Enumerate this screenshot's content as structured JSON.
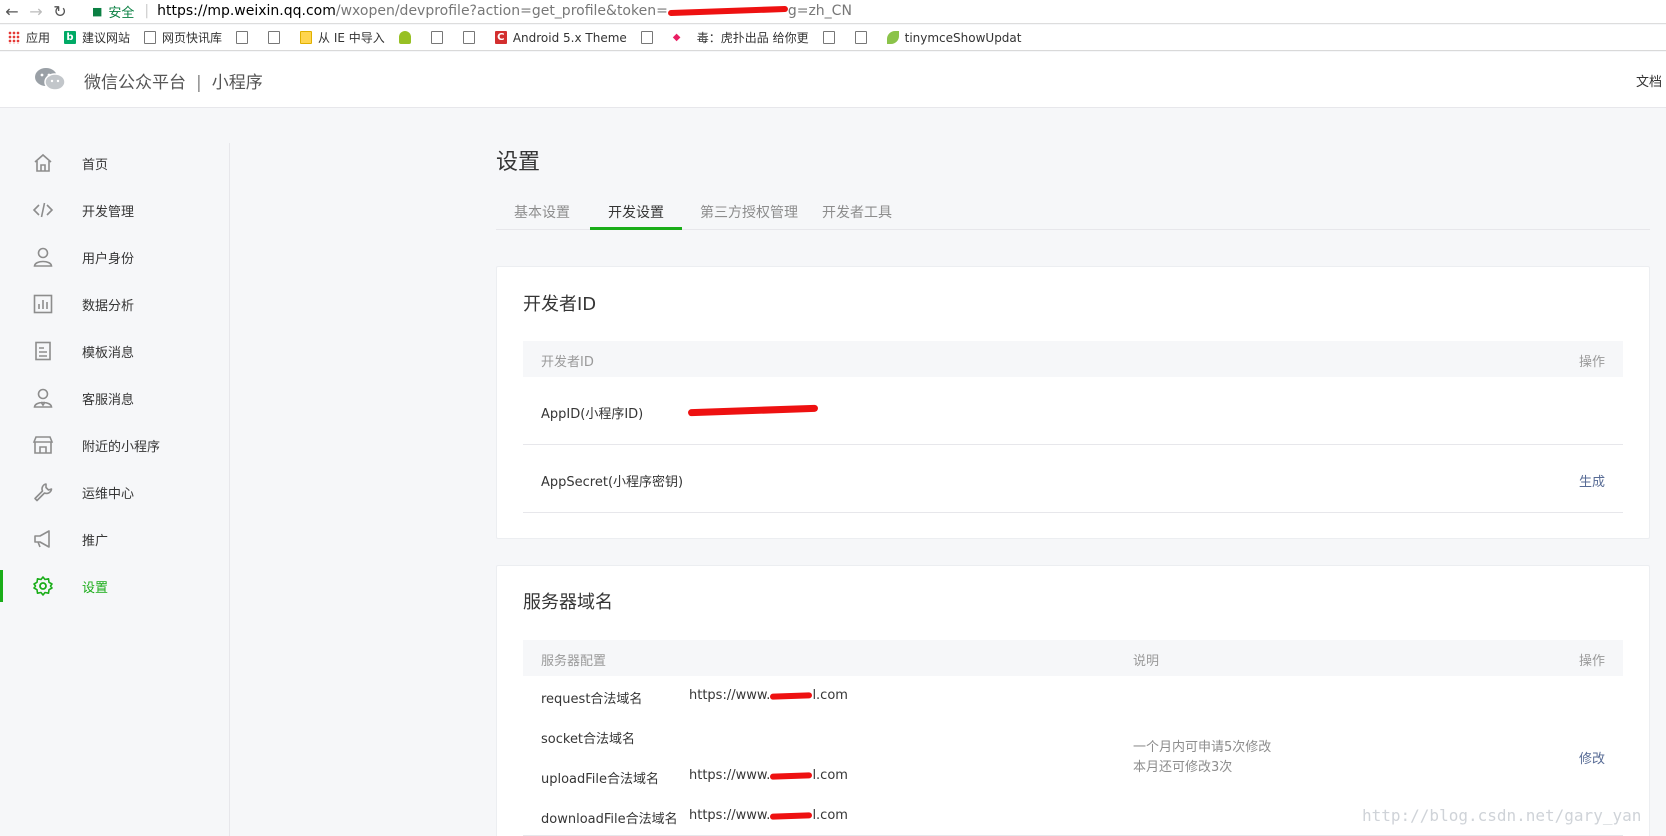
{
  "browser": {
    "secure_label": "安全",
    "url_host": "https://mp.weixin.qq.com",
    "url_path": "/wxopen/devprofile?action=get_profile&token=",
    "url_tail": "g=zh_CN",
    "bookmarks": [
      {
        "icon": "apps-grid-icon",
        "label": "应用"
      },
      {
        "icon": "bing-icon",
        "label": "建议网站"
      },
      {
        "icon": "page-icon",
        "label": "网页快讯库"
      },
      {
        "icon": "page-icon",
        "label": ""
      },
      {
        "icon": "page-icon",
        "label": ""
      },
      {
        "icon": "folder-icon",
        "label": "从 IE 中导入"
      },
      {
        "icon": "android-icon",
        "label": ""
      },
      {
        "icon": "page-icon",
        "label": ""
      },
      {
        "icon": "page-icon",
        "label": ""
      },
      {
        "icon": "c-logo-icon",
        "label": "Android 5.x Theme"
      },
      {
        "icon": "page-icon",
        "label": ""
      },
      {
        "icon": "site-icon",
        "label": "毒：虎扑出品 给你更"
      },
      {
        "icon": "page-icon",
        "label": ""
      },
      {
        "icon": "page-icon",
        "label": ""
      },
      {
        "icon": "leaf-icon",
        "label": "tinymceShowUpdat"
      }
    ]
  },
  "header": {
    "platform": "微信公众平台",
    "divider": "|",
    "product": "小程序",
    "docs": "文档"
  },
  "sidebar": {
    "items": [
      {
        "icon": "home-icon",
        "label": "首页"
      },
      {
        "icon": "code-icon",
        "label": "开发管理"
      },
      {
        "icon": "user-icon",
        "label": "用户身份"
      },
      {
        "icon": "chart-icon",
        "label": "数据分析"
      },
      {
        "icon": "template-icon",
        "label": "模板消息"
      },
      {
        "icon": "service-icon",
        "label": "客服消息"
      },
      {
        "icon": "store-icon",
        "label": "附近的小程序"
      },
      {
        "icon": "wrench-icon",
        "label": "运维中心"
      },
      {
        "icon": "megaphone-icon",
        "label": "推广"
      },
      {
        "icon": "gear-icon",
        "label": "设置"
      }
    ],
    "active_index": 9
  },
  "main": {
    "title": "设置",
    "tabs": [
      "基本设置",
      "开发设置",
      "第三方授权管理",
      "开发者工具"
    ],
    "active_tab": 1,
    "developer_id": {
      "title": "开发者ID",
      "col_id": "开发者ID",
      "col_action": "操作",
      "appid_label": "AppID(小程序ID)",
      "secret_label": "AppSecret(小程序密钥)",
      "secret_action": "生成"
    },
    "server_domain": {
      "title": "服务器域名",
      "col_config": "服务器配置",
      "col_desc": "说明",
      "col_action": "操作",
      "rows": [
        {
          "label": "request合法域名",
          "prefix": "https://www.",
          "suffix": "l.com"
        },
        {
          "label": "socket合法域名",
          "prefix": "",
          "suffix": ""
        },
        {
          "label": "uploadFile合法域名",
          "prefix": "https://www.",
          "suffix": "l.com"
        },
        {
          "label": "downloadFile合法域名",
          "prefix": "https://www.",
          "suffix": "l.com"
        }
      ],
      "desc_line1": "一个月内可申请5次修改",
      "desc_line2": "本月还可修改3次",
      "action": "修改"
    }
  },
  "watermark": "http://blog.csdn.net/gary_yan",
  "colors": {
    "accent": "#1aad19",
    "link": "#576b95",
    "redaction": "#ee1111"
  }
}
